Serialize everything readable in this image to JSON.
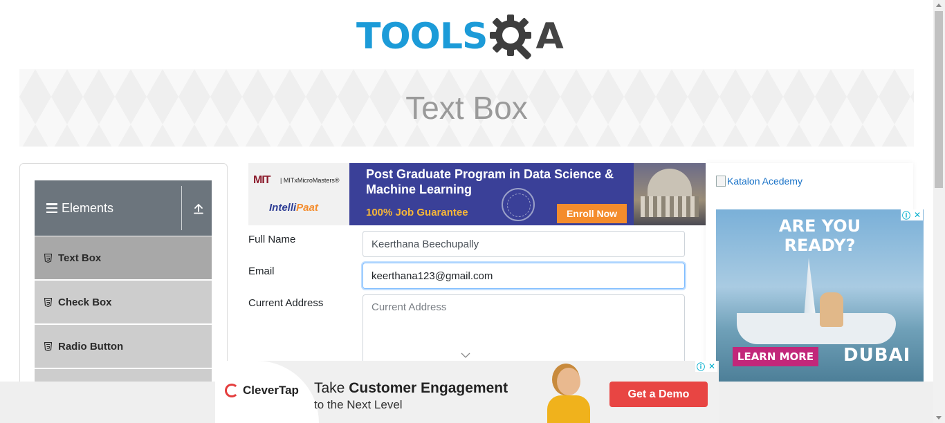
{
  "header": {
    "logo_tools": "TOOLS",
    "logo_a": "A",
    "brand_color": "#1c9bd8"
  },
  "banner": {
    "title": "Text Box"
  },
  "sidebar": {
    "group_title": "Elements",
    "items": [
      {
        "label": "Text Box",
        "active": true
      },
      {
        "label": "Check Box",
        "active": false
      },
      {
        "label": "Radio Button",
        "active": false
      }
    ]
  },
  "center_ad": {
    "mit": "MIT",
    "mitx": "| MITxMicroMasters®",
    "intellipaat_a": "Intelli",
    "intellipaat_b": "Paat",
    "headline": "Post Graduate Program in Data Science & Machine Learning",
    "guarantee": "100% Job Guarantee",
    "cta": "Enroll Now"
  },
  "form": {
    "full_name_label": "Full Name",
    "full_name_value": "Keerthana Beechupally",
    "email_label": "Email",
    "email_value": "keerthana123@gmail.com",
    "current_address_label": "Current Address",
    "current_address_placeholder": "Current Address"
  },
  "right_column": {
    "katalon_alt": "Katalon Acedemy",
    "dubai_ad": {
      "headline": "ARE YOU READY?",
      "cta": "LEARN MORE",
      "brand": "DUBAI"
    }
  },
  "bottom_ad": {
    "brand": "CleverTap",
    "take": "Take",
    "headline": "Customer Engagement",
    "subline": "to the Next Level",
    "cta": "Get a Demo"
  },
  "colors": {
    "sidebar_header": "#6c757d",
    "sidebar_active": "#a8a8a8",
    "focus_border": "#80bdff",
    "enroll_button": "#f48c2c",
    "learn_more_button": "#c2277a",
    "demo_button": "#e84543"
  },
  "icons": [
    "gear-icon",
    "magnifier-icon",
    "hamburger-icon",
    "upload-icon",
    "html5-icon",
    "chevron-down-icon",
    "adchoices-icon",
    "close-icon"
  ]
}
